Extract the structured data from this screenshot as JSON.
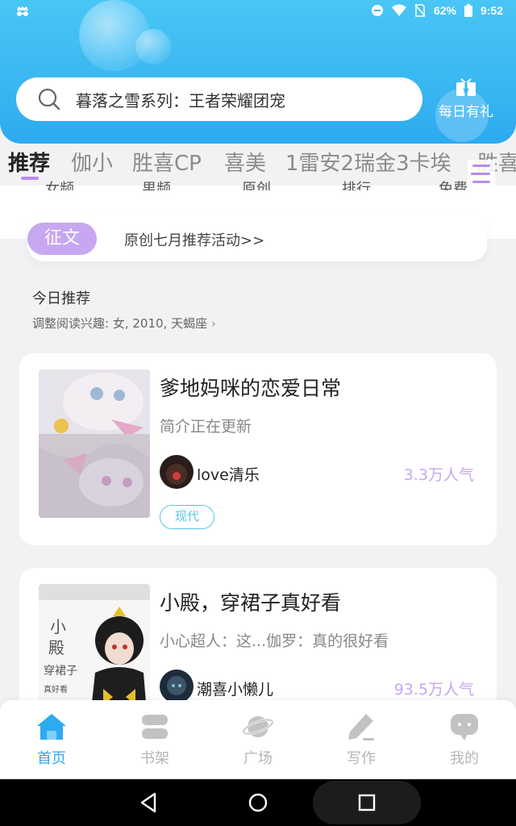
{
  "status_bar": {
    "battery": "62%",
    "time": "9:52"
  },
  "search": {
    "text": "暮落之雪系列：王者荣耀团宠"
  },
  "daily_gift": {
    "label": "每日有礼"
  },
  "category_tabs": [
    "推荐",
    "伽小",
    "胜喜CP",
    "喜美",
    "1雷安2瑞金3卡埃",
    "胜喜"
  ],
  "sub_tabs_partial": [
    "女频",
    "男频",
    "原创",
    "排行",
    "免费"
  ],
  "banner": {
    "badge": "征文",
    "text": "原创七月推荐活动>>"
  },
  "section": {
    "title": "今日推荐",
    "subtitle": "调整阅读兴趣: 女, 2010, 天蝎座"
  },
  "books": [
    {
      "title": "爹地妈咪的恋爱日常",
      "description": "简介正在更新",
      "author": "love清乐",
      "popularity": "3.3万人气",
      "tag": "现代"
    },
    {
      "title": "小殿，穿裙子真好看",
      "description": "小心超人：这...伽罗：真的很好看",
      "author": "潮喜小懒儿",
      "popularity": "93.5万人气"
    }
  ],
  "bottom_nav": [
    {
      "label": "首页",
      "icon": "home-icon",
      "active": true
    },
    {
      "label": "书架",
      "icon": "bookshelf-icon",
      "active": false
    },
    {
      "label": "广场",
      "icon": "planet-icon",
      "active": false
    },
    {
      "label": "写作",
      "icon": "pencil-icon",
      "active": false
    },
    {
      "label": "我的",
      "icon": "chat-bubble-icon",
      "active": false
    }
  ],
  "colors": {
    "header": "#3ab6f1",
    "accent_purple": "#c7a7f0",
    "active_nav": "#2daaf0",
    "tag_cyan": "#55c8e8"
  }
}
